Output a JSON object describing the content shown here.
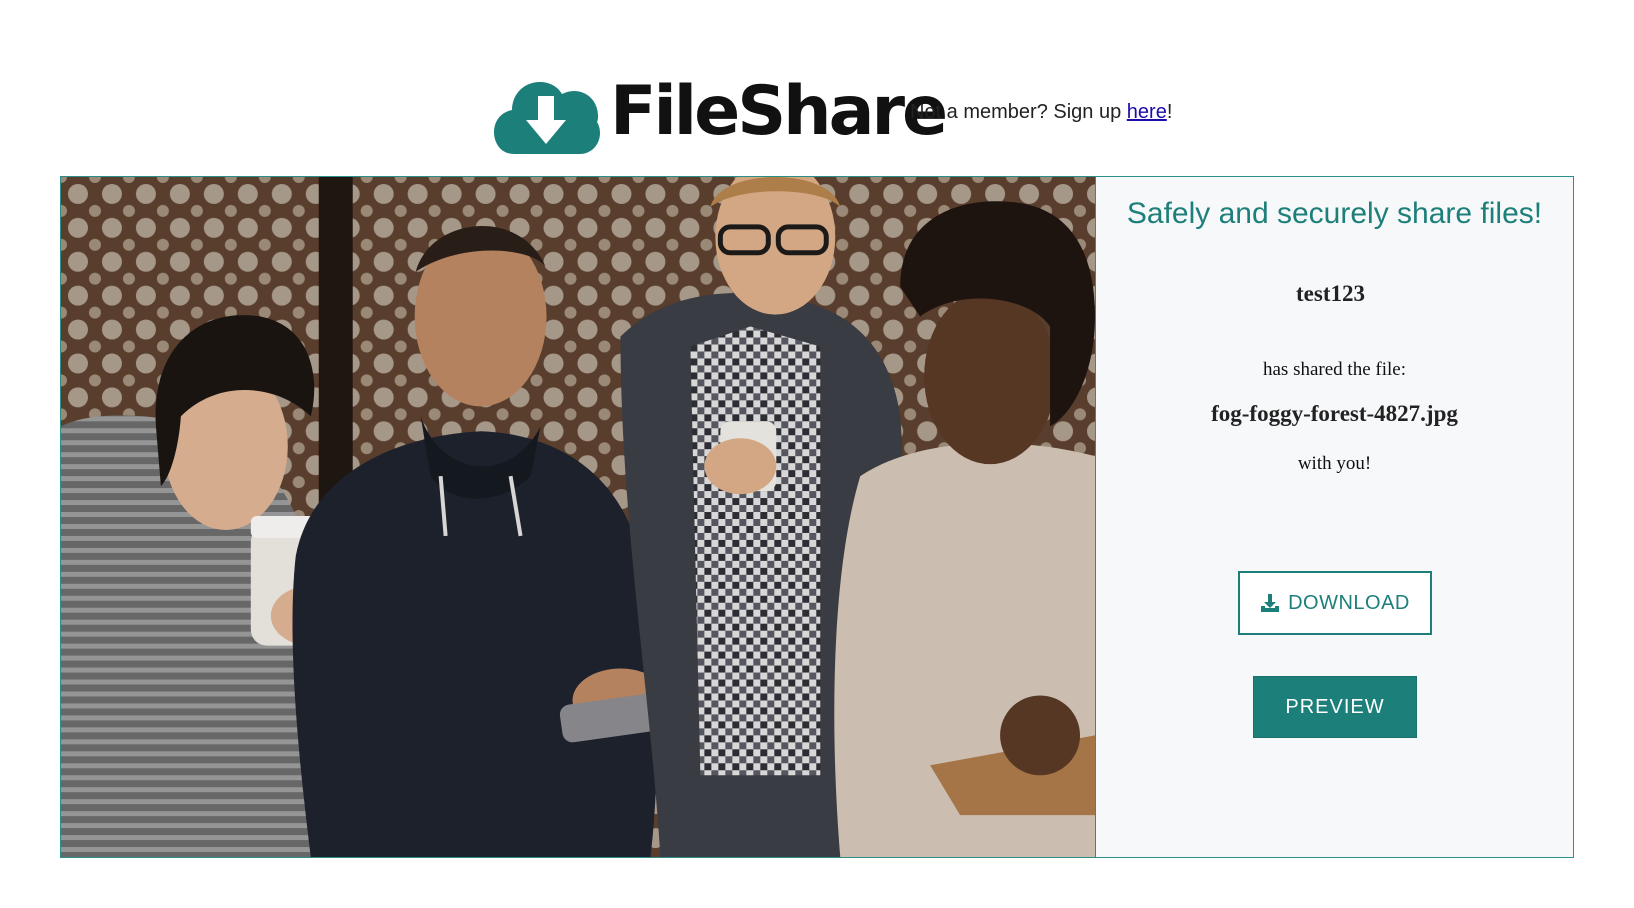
{
  "header": {
    "logo_text": "FileShare",
    "signup_prefix": "Not a member? Sign up ",
    "signup_link": "here",
    "signup_suffix": "!"
  },
  "panel": {
    "tagline": "Safely and securely share files!",
    "username": "test123",
    "shared_text": "has shared the file:",
    "filename": "fog-foggy-forest-4827.jpg",
    "with_you": "with you!",
    "download_label": "DOWNLOAD",
    "preview_label": "PREVIEW"
  },
  "icons": {
    "logo": "cloud-download-icon",
    "download": "download-icon"
  },
  "colors": {
    "accent": "#1d7f7a",
    "link": "#1a0dab",
    "panel_bg": "#f7f8fa"
  }
}
